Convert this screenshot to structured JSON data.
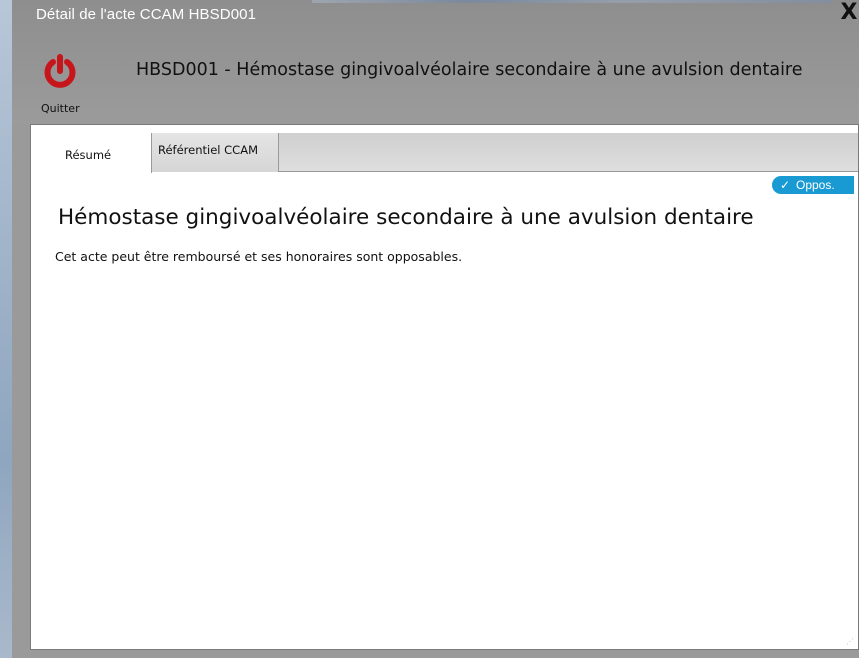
{
  "window": {
    "title": "Détail de l'acte CCAM HBSD001",
    "close_label": "X"
  },
  "toolbar": {
    "quit_label": "Quitter",
    "quit_icon": "power-icon",
    "act_heading": "HBSD001 - Hémostase gingivoalvéolaire secondaire à une avulsion dentaire"
  },
  "tabs": [
    {
      "label": "Résumé",
      "active": true
    },
    {
      "label": "Référentiel CCAM",
      "active": false
    }
  ],
  "badge": {
    "icon": "check-icon",
    "label": "Oppos.",
    "color": "#1a9ad3"
  },
  "summary": {
    "title": "Hémostase gingivoalvéolaire secondaire à une avulsion dentaire",
    "description": "Cet acte peut être remboursé et ses honoraires sont opposables."
  },
  "colors": {
    "quit_icon": "#c7161b",
    "titlebar": "#9a9a9a"
  }
}
